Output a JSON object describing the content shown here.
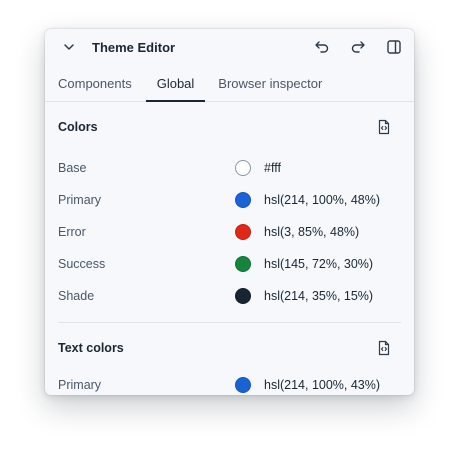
{
  "header": {
    "title": "Theme Editor"
  },
  "tabs": [
    {
      "label": "Components",
      "active": false
    },
    {
      "label": "Global",
      "active": true
    },
    {
      "label": "Browser inspector",
      "active": false
    }
  ],
  "colors": {
    "title": "Colors",
    "items": [
      {
        "label": "Base",
        "value": "#fff",
        "color": "#ffffff"
      },
      {
        "label": "Primary",
        "value": "hsl(214, 100%, 48%)",
        "color": "#1a63d6"
      },
      {
        "label": "Error",
        "value": "hsl(3, 85%, 48%)",
        "color": "#df2818"
      },
      {
        "label": "Success",
        "value": "hsl(145, 72%, 30%)",
        "color": "#15843d"
      },
      {
        "label": "Shade",
        "value": "hsl(214, 35%, 15%)",
        "color": "#192433"
      }
    ]
  },
  "text_colors": {
    "title": "Text colors",
    "items": [
      {
        "label": "Primary",
        "value": "hsl(214, 100%, 43%)",
        "color": "#1a63d6"
      }
    ]
  }
}
